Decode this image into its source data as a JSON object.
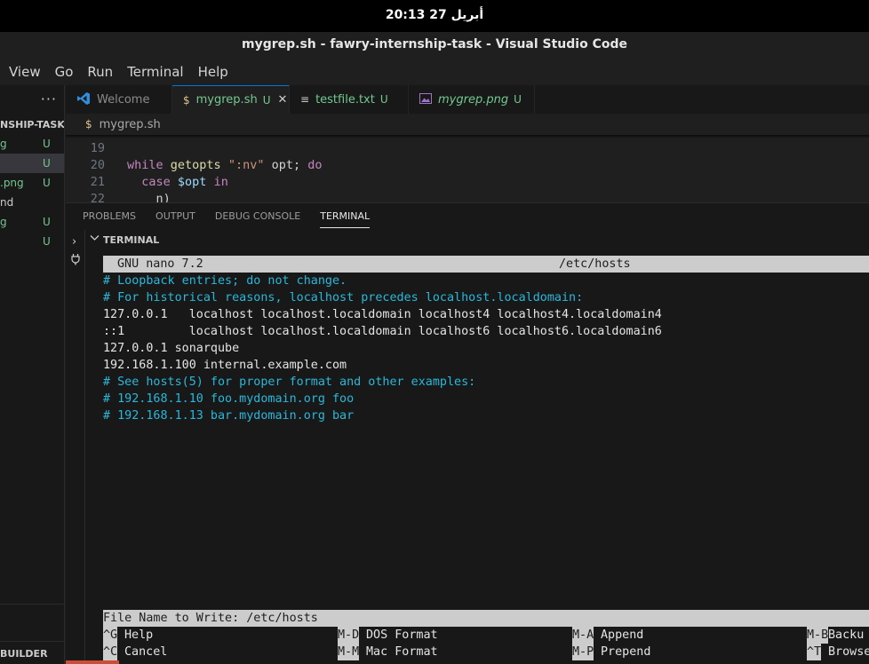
{
  "system": {
    "clock": "20:13  27 أبريل"
  },
  "window": {
    "title": "mygrep.sh - fawry-internship-task - Visual Studio Code"
  },
  "menu": [
    "View",
    "Go",
    "Run",
    "Terminal",
    "Help"
  ],
  "sidebar": {
    "more": "···",
    "explorer_title": "NSHIP-TASK",
    "items": [
      {
        "name": "g",
        "status": "U"
      },
      {
        "name": "",
        "status": "U"
      },
      {
        "name": ".png",
        "status": "U"
      },
      {
        "name": "nd",
        "status": ""
      },
      {
        "name": "g",
        "status": "U"
      },
      {
        "name": "",
        "status": "U"
      }
    ],
    "builder_label": "BUILDER"
  },
  "tabs": [
    {
      "label": "Welcome",
      "status": ""
    },
    {
      "label": "mygrep.sh",
      "status": "U",
      "icon": "$"
    },
    {
      "label": "testfile.txt",
      "status": "U",
      "icon": "≡"
    },
    {
      "label": "mygrep.png",
      "status": "U"
    }
  ],
  "breadcrumb": {
    "icon": "$",
    "label": "mygrep.sh"
  },
  "code": {
    "line_numbers": [
      "19",
      "20",
      "21",
      "22"
    ],
    "line20": {
      "kw1": "while",
      "fn": "getopts",
      "str": "\":nv\"",
      "arg": "opt;",
      "kw2": "do"
    },
    "line21": {
      "kw": "case",
      "var": "$opt",
      "kw2": "in"
    },
    "line22": "n)"
  },
  "panel": {
    "tabs": [
      "PROBLEMS",
      "OUTPUT",
      "DEBUG CONSOLE",
      "TERMINAL"
    ],
    "section_title": "TERMINAL"
  },
  "nano": {
    "version": "GNU nano 7.2",
    "filename": "/etc/hosts",
    "lines": [
      {
        "text": "# Loopback entries; do not change.",
        "type": "comment"
      },
      {
        "text": "# For historical reasons, localhost precedes localhost.localdomain:",
        "type": "comment"
      },
      {
        "text": "127.0.0.1   localhost localhost.localdomain localhost4 localhost4.localdomain4",
        "type": "plain"
      },
      {
        "text": "::1         localhost localhost.localdomain localhost6 localhost6.localdomain6",
        "type": "plain"
      },
      {
        "text": "127.0.0.1 sonarqube",
        "type": "plain"
      },
      {
        "text": "192.168.1.100 internal.example.com",
        "type": "plain"
      },
      {
        "text": "# See hosts(5) for proper format and other examples:",
        "type": "comment"
      },
      {
        "text": "# 192.168.1.10 foo.mydomain.org foo",
        "type": "comment"
      },
      {
        "text": "# 192.168.1.13 bar.mydomain.org bar",
        "type": "comment"
      }
    ],
    "prompt": "File Name to Write: /etc/hosts",
    "shortcuts": [
      {
        "key": "^G",
        "label": "Help"
      },
      {
        "key": "M-D",
        "label": "DOS Format"
      },
      {
        "key": "M-A",
        "label": "Append"
      },
      {
        "key": "M-B",
        "label": "Backu"
      },
      {
        "key": "^C",
        "label": "Cancel"
      },
      {
        "key": "M-M",
        "label": "Mac Format"
      },
      {
        "key": "M-P",
        "label": "Prepend"
      },
      {
        "key": "^T",
        "label": "Browse"
      }
    ]
  }
}
